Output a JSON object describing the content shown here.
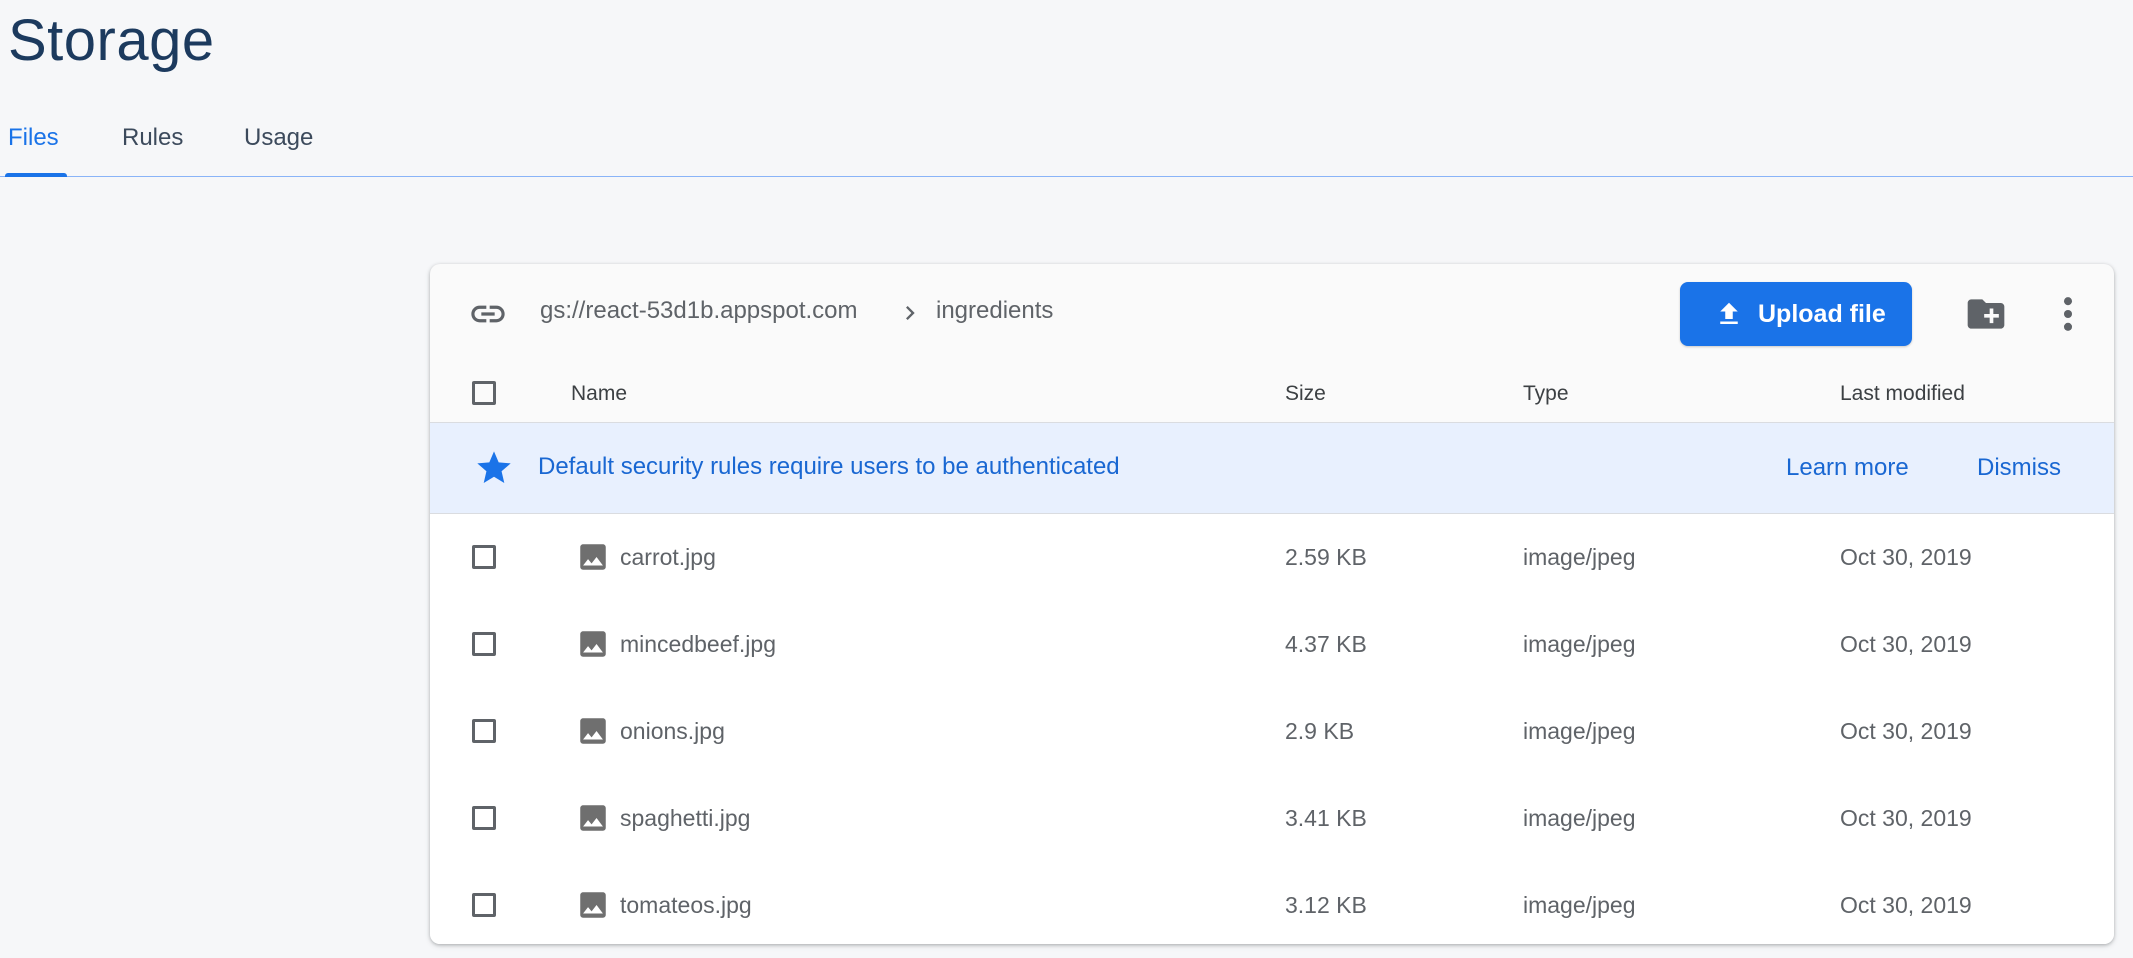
{
  "page": {
    "title": "Storage"
  },
  "tabs": [
    {
      "label": "Files",
      "active": true
    },
    {
      "label": "Rules",
      "active": false
    },
    {
      "label": "Usage",
      "active": false
    }
  ],
  "toolbar": {
    "bucket": "gs://react-53d1b.appspot.com",
    "folder": "ingredients",
    "upload_label": "Upload file"
  },
  "table": {
    "columns": [
      "Name",
      "Size",
      "Type",
      "Last modified"
    ],
    "rows": [
      {
        "name": "carrot.jpg",
        "size": "2.59 KB",
        "type": "image/jpeg",
        "modified": "Oct 30, 2019"
      },
      {
        "name": "mincedbeef.jpg",
        "size": "4.37 KB",
        "type": "image/jpeg",
        "modified": "Oct 30, 2019"
      },
      {
        "name": "onions.jpg",
        "size": "2.9 KB",
        "type": "image/jpeg",
        "modified": "Oct 30, 2019"
      },
      {
        "name": "spaghetti.jpg",
        "size": "3.41 KB",
        "type": "image/jpeg",
        "modified": "Oct 30, 2019"
      },
      {
        "name": "tomateos.jpg",
        "size": "3.12 KB",
        "type": "image/jpeg",
        "modified": "Oct 30, 2019"
      }
    ]
  },
  "banner": {
    "message": "Default security rules require users to be authenticated",
    "learn_more": "Learn more",
    "dismiss": "Dismiss"
  },
  "icons": {
    "link": "link-icon",
    "breadcrumb_separator": "chevron-right-icon",
    "upload": "upload-icon",
    "new_folder": "create-folder-icon",
    "more": "more-vert-icon",
    "banner": "star-icon",
    "file": "image-icon"
  },
  "colors": {
    "accent": "#1a73e8",
    "banner_bg": "#e8f0fe",
    "banner_text": "#1967d2",
    "title": "#1c3a5e"
  }
}
